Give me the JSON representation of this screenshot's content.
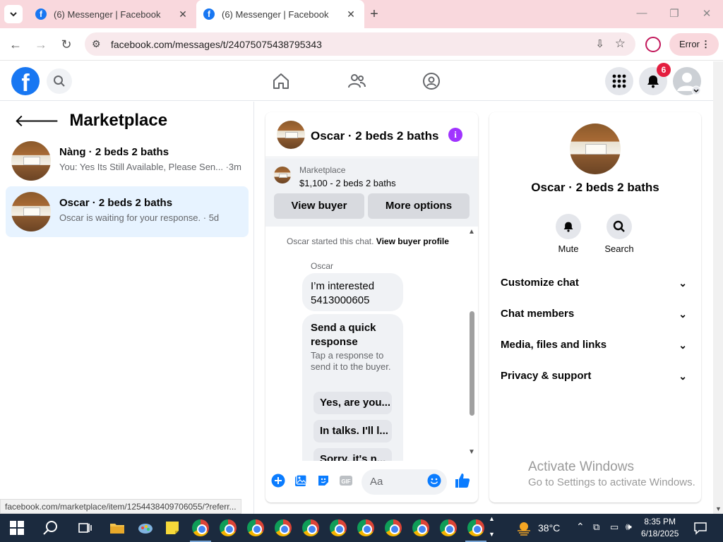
{
  "browser": {
    "tabs": [
      {
        "title": "(6) Messenger | Facebook",
        "active": false
      },
      {
        "title": "(6) Messenger | Facebook",
        "active": true
      }
    ],
    "url": "facebook.com/messages/t/24075075438795343",
    "error_label": "Error",
    "status_url": "facebook.com/marketplace/item/1254438409706055/?referr..."
  },
  "header": {
    "notification_count": "6"
  },
  "sidebar": {
    "title": "Marketplace",
    "conversations": [
      {
        "name": "Nàng · 2 beds 2 baths",
        "preview": "You: Yes Its Still Available, Please Sen... ·3m",
        "selected": false
      },
      {
        "name": "Oscar · 2 beds 2 baths",
        "preview": "Oscar is waiting for your response. · 5d",
        "selected": true
      }
    ]
  },
  "chat": {
    "title": "Oscar · 2 beds 2 baths",
    "marketplace_label": "Marketplace",
    "listing": "$1,100 - 2 beds 2 baths",
    "view_buyer": "View buyer",
    "more_options": "More options",
    "started_text": "Oscar started this chat.",
    "view_buyer_profile": "View buyer profile",
    "sender": "Oscar",
    "message": "I’m interested 5413000605",
    "quick_response_title": "Send a quick response",
    "quick_response_sub": "Tap a response to send it to the buyer.",
    "quick_replies": [
      "Yes, are you...",
      "In talks. I'll l...",
      "Sorry, it's n..."
    ],
    "composer_placeholder": "Aa"
  },
  "right_panel": {
    "title": "Oscar · 2 beds 2 baths",
    "actions": [
      {
        "label": "Mute",
        "icon": "bell-icon"
      },
      {
        "label": "Search",
        "icon": "search-icon"
      }
    ],
    "sections": [
      "Customize chat",
      "Chat members",
      "Media, files and links",
      "Privacy & support"
    ]
  },
  "watermark": {
    "line1": "Activate Windows",
    "line2": "Go to Settings to activate Windows."
  },
  "taskbar": {
    "temperature": "38°C",
    "time": "8:35 PM",
    "date": "6/18/2025"
  },
  "colors": {
    "fb_blue": "#1877f2",
    "messenger_blue": "#0a7cff",
    "tab_bar": "#f9d8dd",
    "selected_row": "#e7f3ff",
    "badge_red": "#e41e3f",
    "info_purple": "#a033ff"
  }
}
